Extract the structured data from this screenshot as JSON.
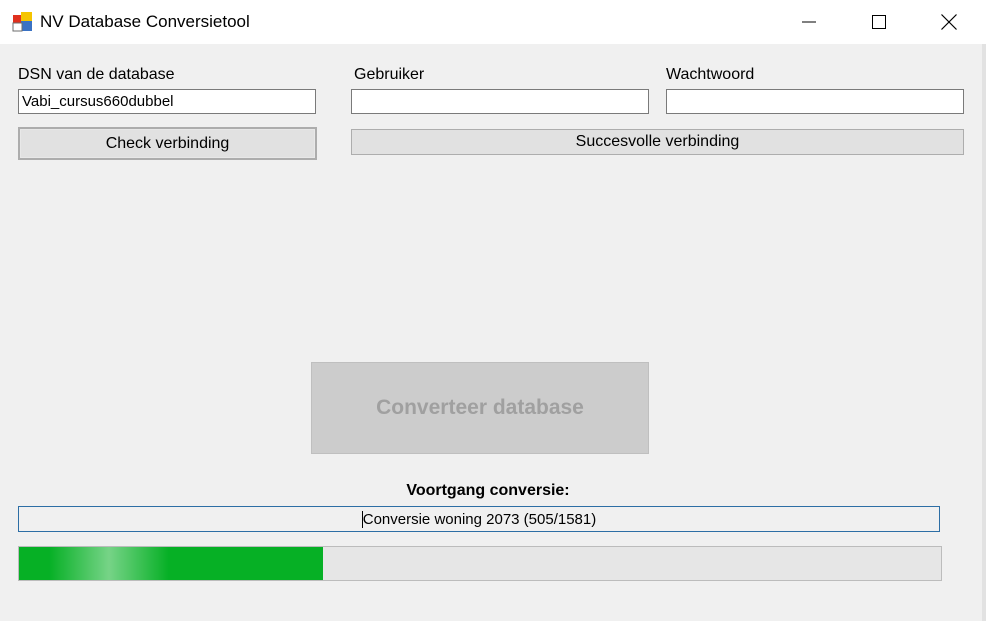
{
  "window": {
    "title": "NV Database Conversietool",
    "controls": {
      "minimize": "minimize-icon",
      "maximize": "maximize-icon",
      "close": "close-icon"
    }
  },
  "connection": {
    "dsn_label": "DSN van de database",
    "dsn_value": "Vabi_cursus660dubbel",
    "user_label": "Gebruiker",
    "user_value": "",
    "password_label": "Wachtwoord",
    "password_value": "",
    "check_button": "Check verbinding",
    "status_button": "Succesvolle verbinding"
  },
  "conversion": {
    "convert_button": "Converteer database",
    "progress_label": "Voortgang conversie:",
    "status_text": "Conversie woning 2073 (505/1581)",
    "progress_fraction": 0.33
  },
  "colors": {
    "progress_fill": "#06b025",
    "window_bg": "#f0f0f0",
    "status_border": "#2d6ea5"
  }
}
